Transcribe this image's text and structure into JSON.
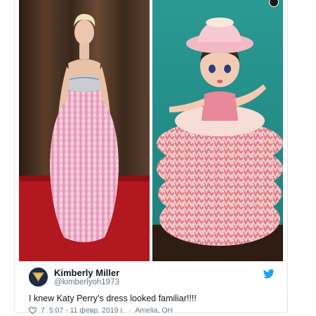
{
  "tweet": {
    "author_name": "Kimberly Miller",
    "author_handle": "@kimberlyoh1973",
    "text": "I knew Katy Perry’s dress looked familiar!!!!",
    "likes": "7",
    "timestamp": "5:07 - 11 февр. 2019 г.",
    "location": "Amelia, OH",
    "separator": "·"
  },
  "icons": {
    "twitter": "twitter-bird-icon",
    "like": "heart-icon",
    "info": "info-icon"
  },
  "colors": {
    "twitter_blue": "#1da1f2",
    "meta_gray": "#657786",
    "text": "#14171a"
  }
}
